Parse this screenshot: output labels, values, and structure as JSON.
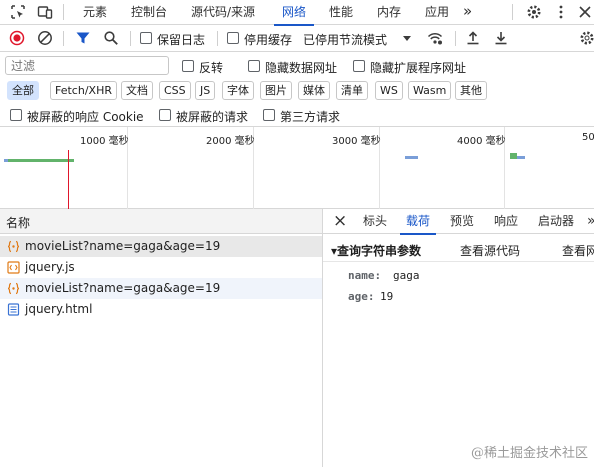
{
  "tabs": {
    "elements": "元素",
    "console": "控制台",
    "sources": "源代码/来源",
    "network": "网络",
    "performance": "性能",
    "memory": "内存",
    "application": "应用",
    "more": "»"
  },
  "toolbar": {
    "preserve_log": "保留日志",
    "disable_cache": "停用缓存",
    "throttling": "已停用节流模式"
  },
  "filter": {
    "placeholder": "过滤",
    "invert": "反转",
    "hide_data_urls": "隐藏数据网址",
    "hide_extension_urls": "隐藏扩展程序网址"
  },
  "types": [
    "全部",
    "Fetch/XHR",
    "文档",
    "CSS",
    "JS",
    "字体",
    "图片",
    "媒体",
    "清单",
    "WS",
    "Wasm",
    "其他"
  ],
  "blocked": {
    "cookies": "被屏蔽的响应 Cookie",
    "requests": "被屏蔽的请求",
    "third_party": "第三方请求"
  },
  "timeline": {
    "labels": [
      "1000 毫秒",
      "2000 毫秒",
      "3000 毫秒",
      "4000 毫秒",
      "50"
    ]
  },
  "list": {
    "header": "名称",
    "rows": [
      {
        "name": "movieList?name=gaga&age=19",
        "type": "xhr"
      },
      {
        "name": "jquery.js",
        "type": "script"
      },
      {
        "name": "movieList?name=gaga&age=19",
        "type": "xhr"
      },
      {
        "name": "jquery.html",
        "type": "doc"
      }
    ]
  },
  "detail": {
    "close": "×",
    "tabs": [
      "标头",
      "载荷",
      "预览",
      "响应",
      "启动器"
    ],
    "more": "»",
    "section_title": "▾查询字符串参数",
    "view_source": "查看源代码",
    "view_url": "查看网",
    "params": [
      {
        "key": "name:",
        "value": "gaga"
      },
      {
        "key": "age:",
        "value": "19"
      }
    ]
  },
  "watermark": "@稀土掘金技术社区",
  "colors": {
    "accent": "#1a57c8",
    "record": "#e0162b",
    "waiting_bar": "#62b36b",
    "xhr_icon": "#e07a16",
    "doc_icon": "#3a73d4"
  }
}
